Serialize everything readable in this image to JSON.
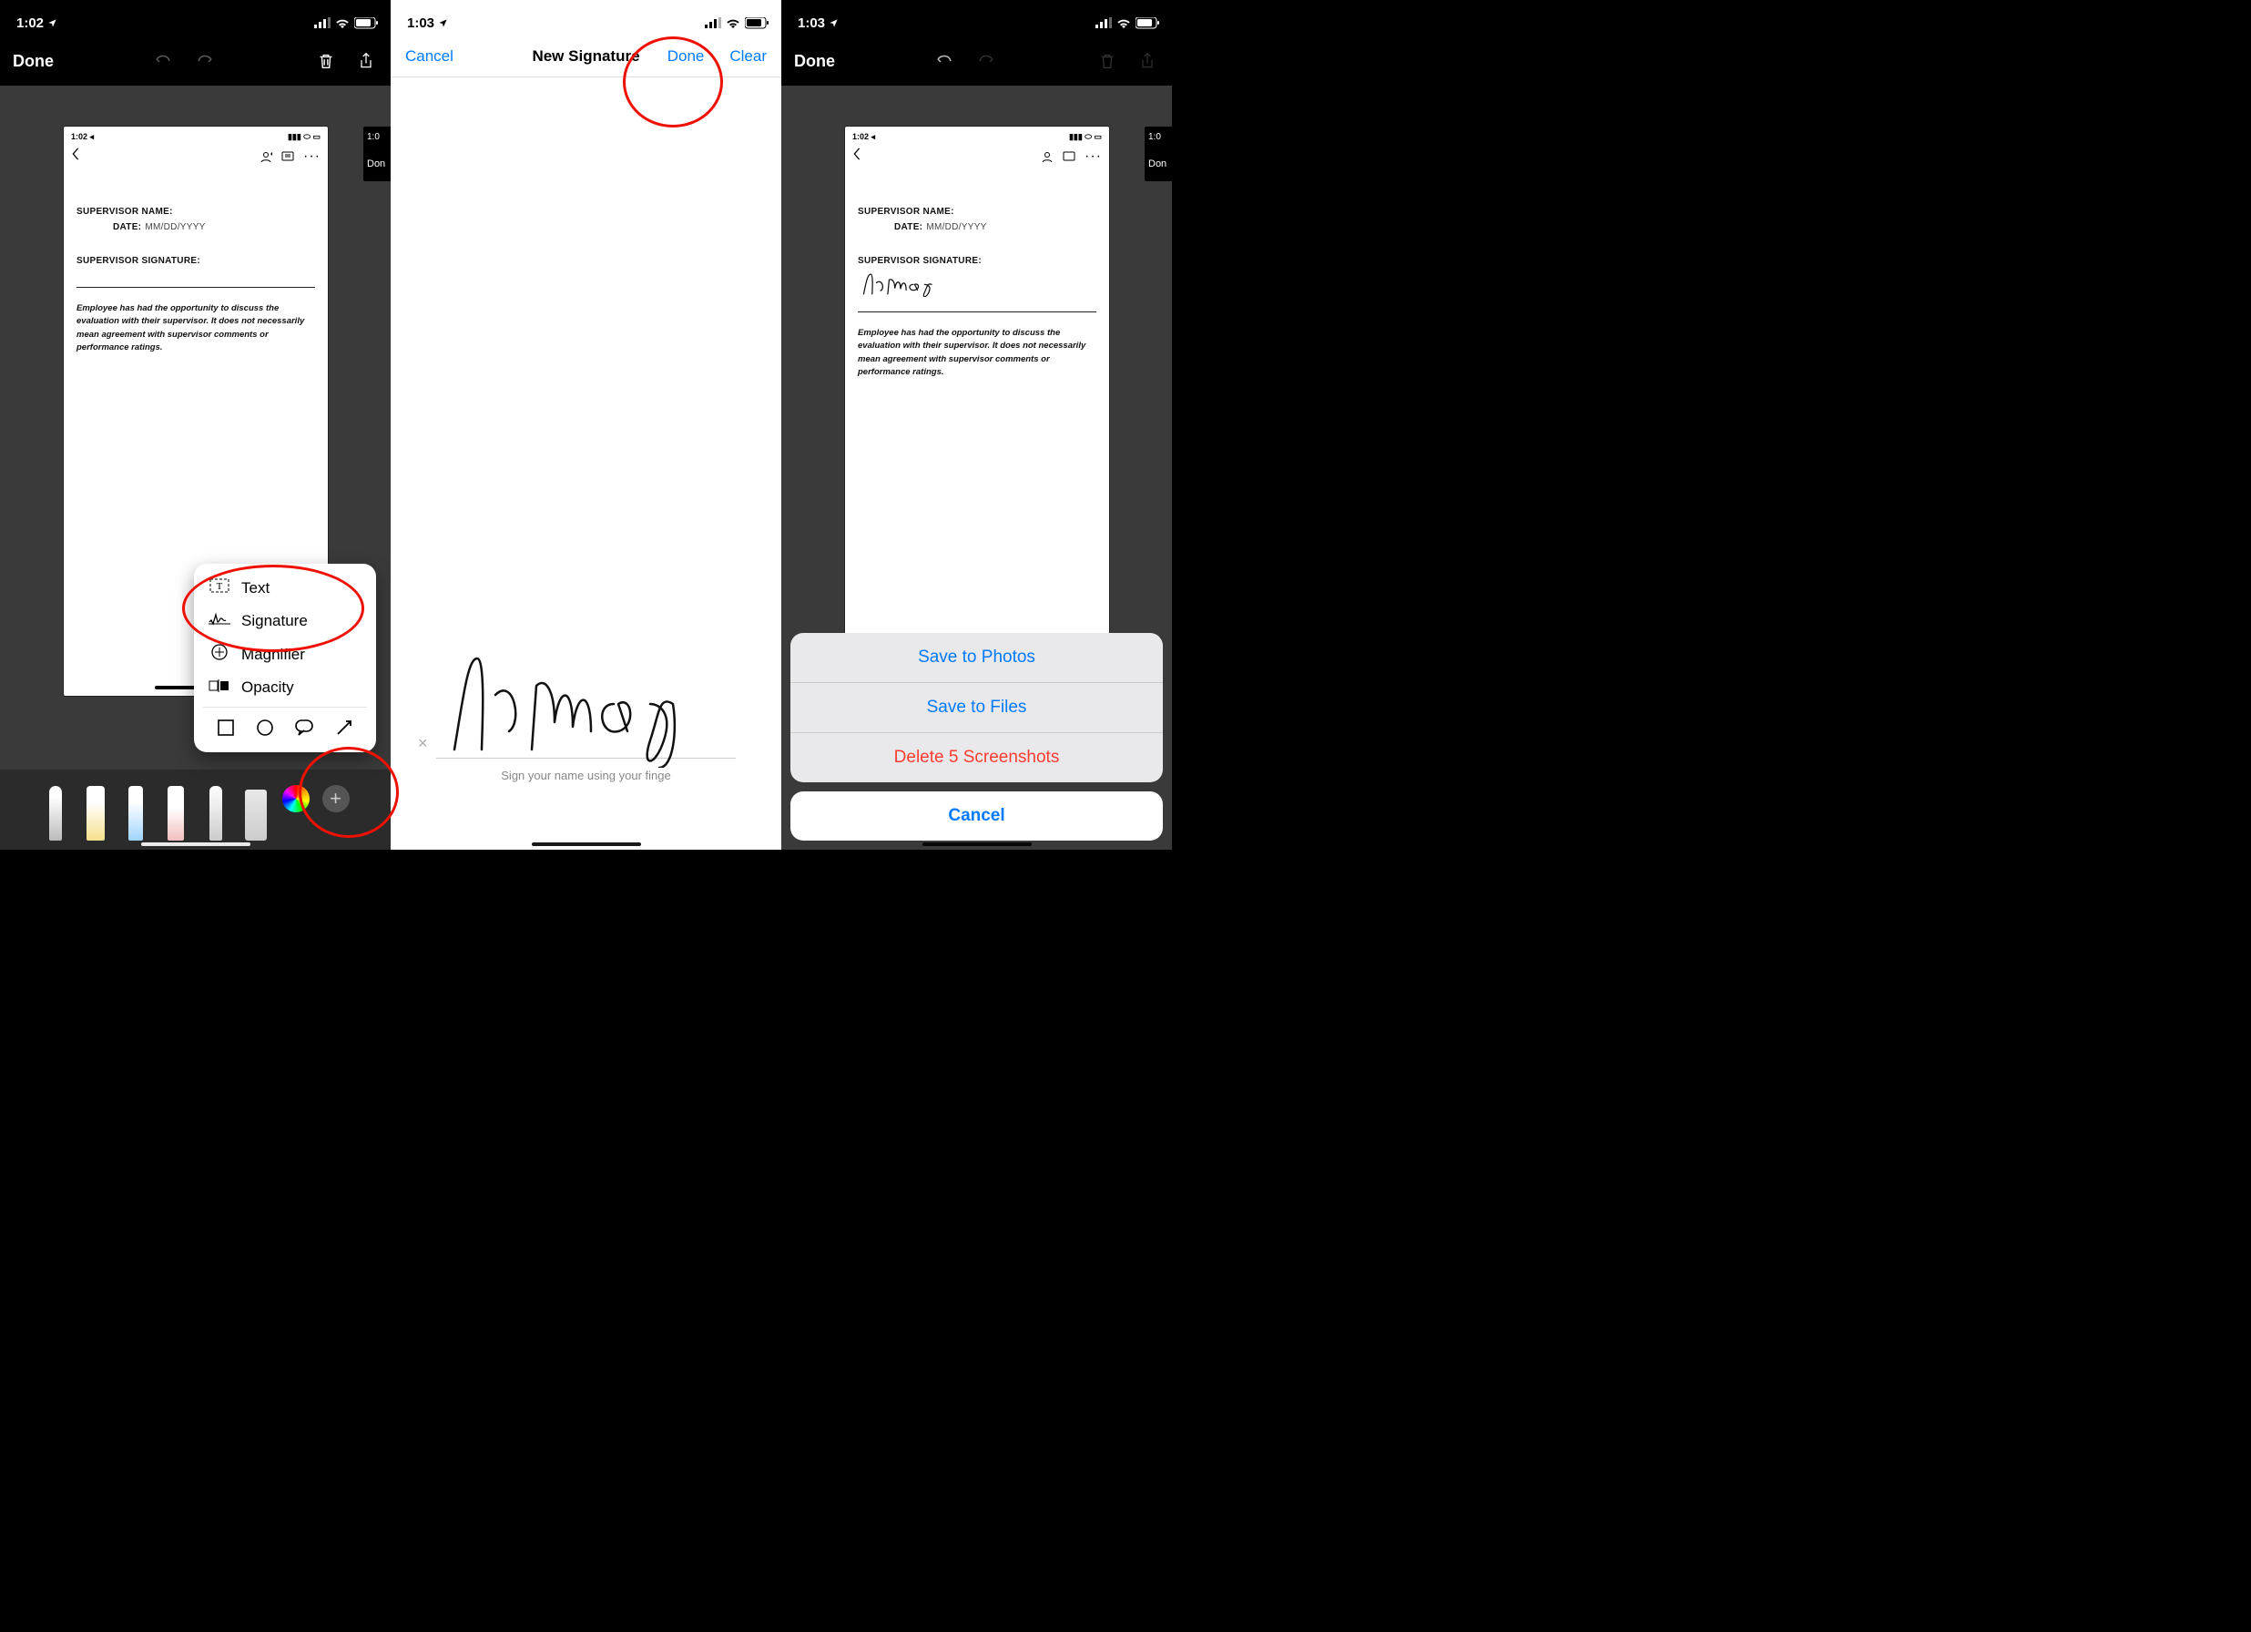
{
  "status": {
    "time_p1": "1:02",
    "time_p2": "1:03",
    "time_p3": "1:03",
    "time_thumb": "1:02"
  },
  "markup_nav": {
    "done": "Done"
  },
  "doc": {
    "field_supervisor": "SUPERVISOR NAME:",
    "field_date_label": "DATE:",
    "field_date_value": "MM/DD/YYYY",
    "field_sig": "SUPERVISOR SIGNATURE:",
    "disclaimer": "Employee has had the opportunity to discuss the evaluation with their supervisor. It does not necessarily mean agreement with supervisor comments or performance ratings."
  },
  "thumb_next": {
    "time": "1:0",
    "text": "Don"
  },
  "popup": {
    "text": "Text",
    "signature": "Signature",
    "magnifier": "Magnifier",
    "opacity": "Opacity"
  },
  "sig_modal": {
    "cancel": "Cancel",
    "title": "New Signature",
    "done": "Done",
    "clear": "Clear",
    "hint_prefix": "Sign your name using your finge",
    "x": "×"
  },
  "sheet": {
    "photos": "Save to Photos",
    "files": "Save to Files",
    "delete": "Delete 5 Screenshots",
    "cancel": "Cancel"
  }
}
